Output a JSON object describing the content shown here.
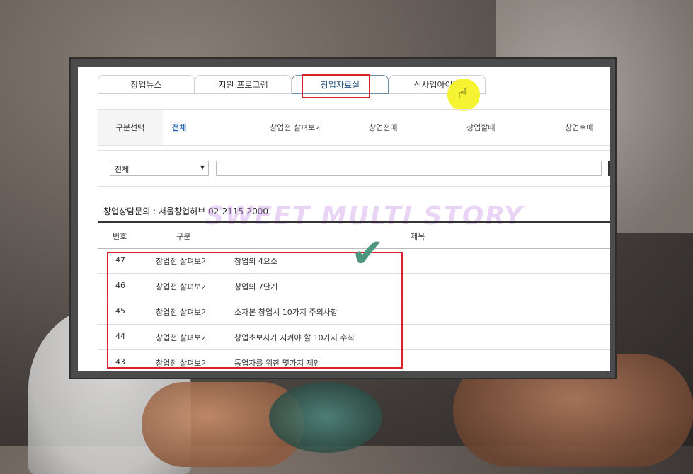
{
  "tabs": [
    {
      "label": "창업뉴스",
      "active": false
    },
    {
      "label": "지원 프로그램",
      "active": false
    },
    {
      "label": "창업자료실",
      "active": true
    },
    {
      "label": "신사업아이템",
      "active": false
    }
  ],
  "filter": {
    "label": "구분선택",
    "options": [
      "전체",
      "창업전 살펴보기",
      "창업전에",
      "창업할때",
      "창업후에"
    ],
    "selected": "전체"
  },
  "search": {
    "select_value": "전체",
    "input_value": ""
  },
  "contact": "창업상담문의 : 서울창업허브 02-2115-2000",
  "watermark": "SWEET MULTI STORY",
  "table": {
    "headers": [
      "번호",
      "구분",
      "제목"
    ],
    "rows": [
      {
        "num": "47",
        "category": "창업전 살펴보기",
        "title": "창업의 4요소"
      },
      {
        "num": "46",
        "category": "창업전 살펴보기",
        "title": "창업의 7단계"
      },
      {
        "num": "45",
        "category": "창업전 살펴보기",
        "title": "소자본 창업시 10가지 주의사항"
      },
      {
        "num": "44",
        "category": "창업전 살펴보기",
        "title": "창업초보자가 지켜야 할 10가지 수칙"
      },
      {
        "num": "43",
        "category": "창업전 살펴보기",
        "title": "동업자를 위한 몇가지 제안"
      }
    ]
  },
  "colors": {
    "highlight": "#d8232a",
    "checkmark": "#4e9580",
    "active_filter": "#2a64b0",
    "cursor_glow": "#f5f227"
  },
  "icons": {
    "cursor": "pointer-hand-icon",
    "check": "checkmark-icon",
    "dropdown": "chevron-down-icon"
  }
}
